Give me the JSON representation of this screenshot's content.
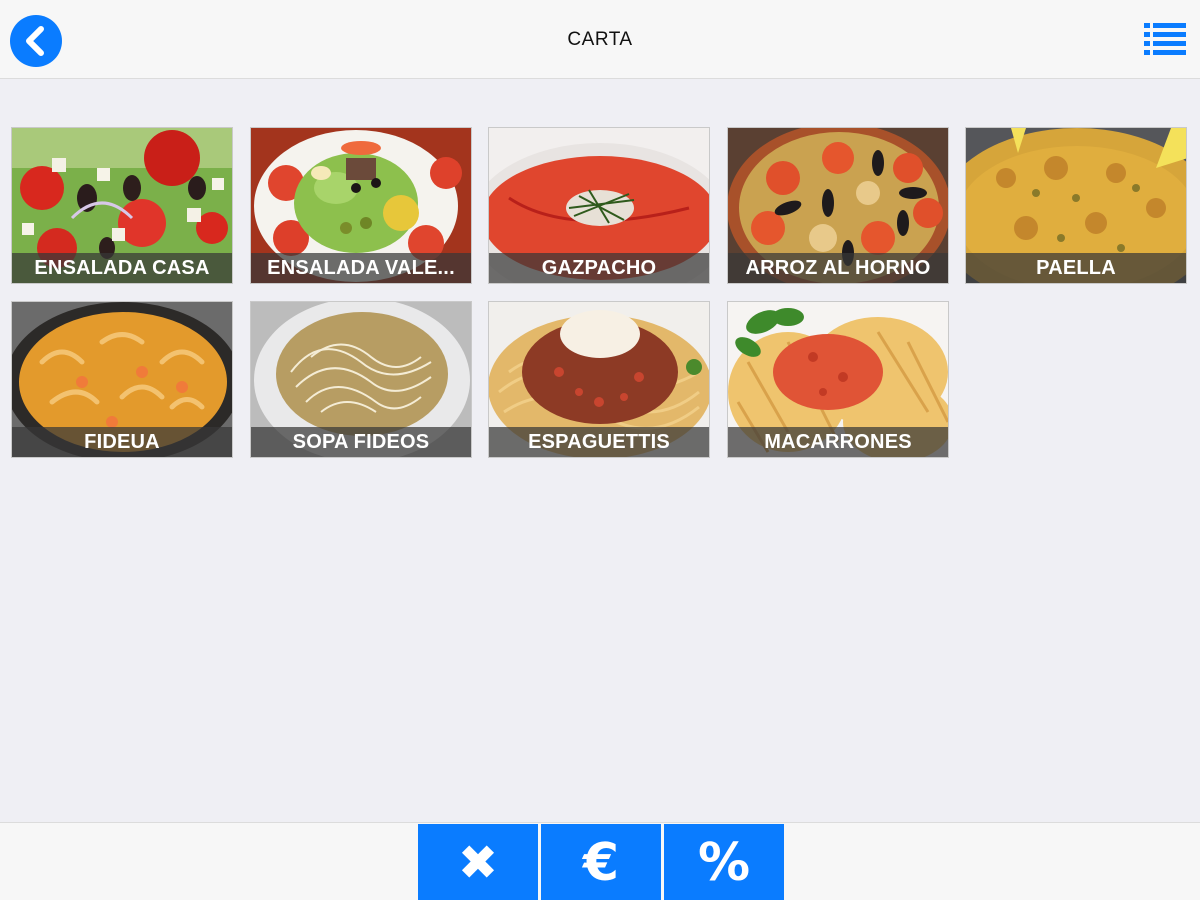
{
  "header": {
    "title": "CARTA",
    "back_icon": "chevron-left-icon",
    "menu_icon": "list-icon",
    "accent": "#0a7cff"
  },
  "menu": {
    "items": [
      {
        "label": "ENSALADA CASA"
      },
      {
        "label": "ENSALADA VALE..."
      },
      {
        "label": "GAZPACHO"
      },
      {
        "label": "ARROZ AL HORNO"
      },
      {
        "label": "PAELLA"
      },
      {
        "label": "FIDEUA"
      },
      {
        "label": "SOPA FIDEOS"
      },
      {
        "label": "ESPAGUETTIS"
      },
      {
        "label": "MACARRONES"
      }
    ]
  },
  "toolbar": {
    "cancel_glyph": "✖",
    "price_glyph": "€",
    "discount_glyph": "%"
  }
}
